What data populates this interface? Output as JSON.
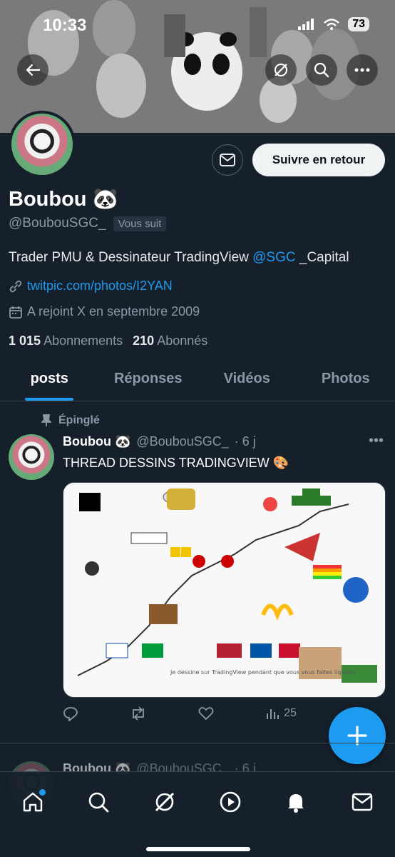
{
  "status_bar": {
    "time": "10:33",
    "battery": "73"
  },
  "profile": {
    "name": "Boubou 🐼",
    "handle": "@BoubouSGC_",
    "follows_you": "Vous suit",
    "follow_button": "Suivre en retour",
    "bio_text": "Trader PMU & Dessinateur TradingView ",
    "bio_mention": "@SGC",
    "bio_suffix": " _Capital",
    "website": "twitpic.com/photos/I2YAN",
    "joined": "A rejoint X en septembre 2009",
    "following_count": "1 015",
    "following_label": "Abonnements",
    "followers_count": "210",
    "followers_label": "Abonnés"
  },
  "tabs": [
    {
      "label": "posts"
    },
    {
      "label": "Réponses"
    },
    {
      "label": "Vidéos"
    },
    {
      "label": "Photos"
    }
  ],
  "pinned_post": {
    "pinned_label": "Épinglé",
    "name": "Boubou 🐼",
    "handle": "@BoubouSGC_",
    "time": "· 6 j",
    "text": "THREAD DESSINS TRADINGVIEW 🎨",
    "image_caption": "Je dessine sur TradingView pendant que vous vous faites liquider",
    "views": "25"
  },
  "next_post": {
    "name": "Boubou 🐼",
    "handle": "@BoubouSGC_",
    "time": "· 6 j"
  },
  "icons": {
    "accent": "#1d9bf0"
  }
}
